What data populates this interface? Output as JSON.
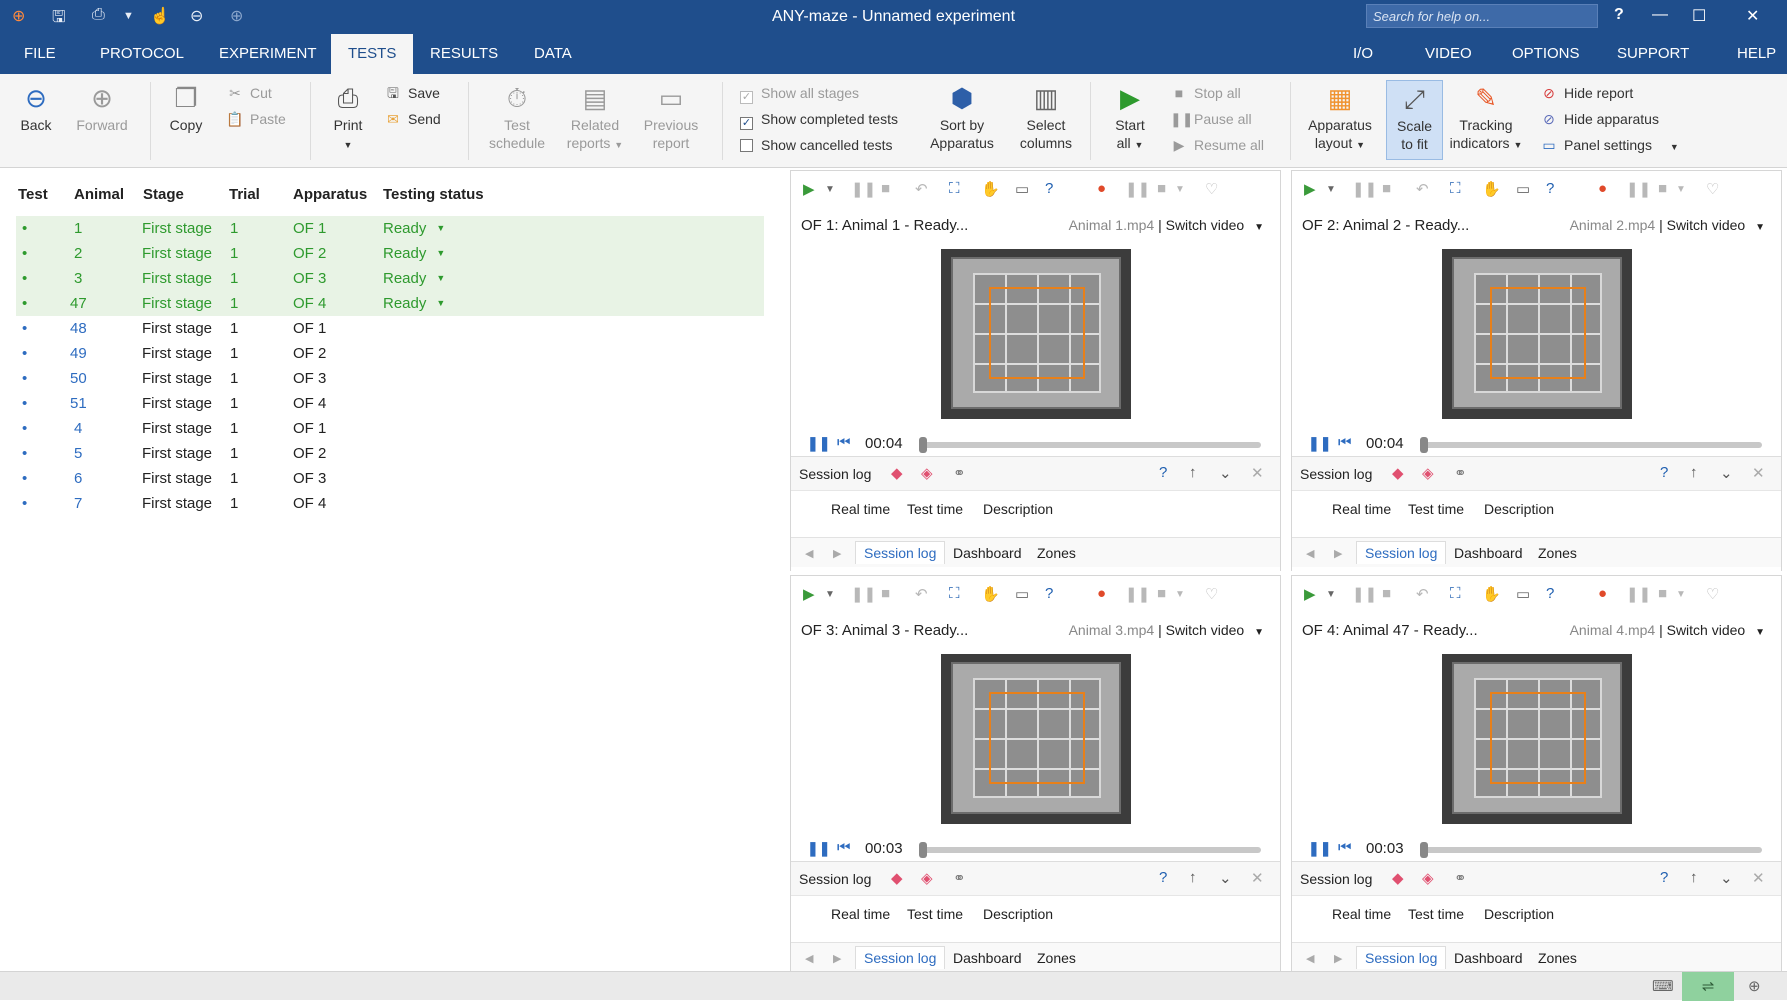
{
  "titlebar": {
    "title": "ANY-maze - Unnamed experiment",
    "search_placeholder": "Search for help on...",
    "help": "?"
  },
  "menu": {
    "left": [
      "FILE",
      "PROTOCOL",
      "EXPERIMENT",
      "TESTS",
      "RESULTS",
      "DATA"
    ],
    "right": [
      "I/O",
      "VIDEO",
      "OPTIONS",
      "SUPPORT",
      "HELP"
    ],
    "active": "TESTS"
  },
  "ribbon": {
    "back": "Back",
    "forward": "Forward",
    "copy": "Copy",
    "cut": "Cut",
    "paste": "Paste",
    "print": "Print",
    "save": "Save",
    "send": "Send",
    "test_schedule": [
      "Test",
      "schedule"
    ],
    "related_reports": [
      "Related",
      "reports"
    ],
    "previous_report": [
      "Previous",
      "report"
    ],
    "show_all_stages": "Show all stages",
    "show_completed_tests": "Show completed tests",
    "show_cancelled_tests": "Show cancelled tests",
    "sort_by": [
      "Sort by",
      "Apparatus"
    ],
    "select_columns": [
      "Select",
      "columns"
    ],
    "start_all": [
      "Start",
      "all"
    ],
    "stop_all": "Stop all",
    "pause_all": "Pause all",
    "resume_all": "Resume all",
    "apparatus_layout": [
      "Apparatus",
      "layout"
    ],
    "scale_to_fit": [
      "Scale",
      "to fit"
    ],
    "tracking_indicators": [
      "Tracking",
      "indicators"
    ],
    "hide_report": "Hide report",
    "hide_apparatus": "Hide apparatus",
    "panel_settings": "Panel settings"
  },
  "tests_table": {
    "headers": [
      "Test",
      "Animal",
      "Stage",
      "Trial",
      "Apparatus",
      "Testing status"
    ],
    "rows": [
      {
        "animal": "1",
        "stage": "First stage",
        "trial": "1",
        "apparatus": "OF 1",
        "status": "Ready"
      },
      {
        "animal": "2",
        "stage": "First stage",
        "trial": "1",
        "apparatus": "OF 2",
        "status": "Ready"
      },
      {
        "animal": "3",
        "stage": "First stage",
        "trial": "1",
        "apparatus": "OF 3",
        "status": "Ready"
      },
      {
        "animal": "47",
        "stage": "First stage",
        "trial": "1",
        "apparatus": "OF 4",
        "status": "Ready"
      },
      {
        "animal": "48",
        "stage": "First stage",
        "trial": "1",
        "apparatus": "OF 1",
        "status": ""
      },
      {
        "animal": "49",
        "stage": "First stage",
        "trial": "1",
        "apparatus": "OF 2",
        "status": ""
      },
      {
        "animal": "50",
        "stage": "First stage",
        "trial": "1",
        "apparatus": "OF 3",
        "status": ""
      },
      {
        "animal": "51",
        "stage": "First stage",
        "trial": "1",
        "apparatus": "OF 4",
        "status": ""
      },
      {
        "animal": "4",
        "stage": "First stage",
        "trial": "1",
        "apparatus": "OF 1",
        "status": ""
      },
      {
        "animal": "5",
        "stage": "First stage",
        "trial": "1",
        "apparatus": "OF 2",
        "status": ""
      },
      {
        "animal": "6",
        "stage": "First stage",
        "trial": "1",
        "apparatus": "OF 3",
        "status": ""
      },
      {
        "animal": "7",
        "stage": "First stage",
        "trial": "1",
        "apparatus": "OF 4",
        "status": ""
      }
    ]
  },
  "panels": [
    {
      "title": "OF 1: Animal 1 - Ready...",
      "file": "Animal 1.mp4",
      "switch": "Switch video",
      "time": "00:04"
    },
    {
      "title": "OF 2: Animal 2 - Ready...",
      "file": "Animal 2.mp4",
      "switch": "Switch video",
      "time": "00:04"
    },
    {
      "title": "OF 3: Animal 3 - Ready...",
      "file": "Animal 3.mp4",
      "switch": "Switch video",
      "time": "00:03"
    },
    {
      "title": "OF 4: Animal 47 - Ready...",
      "file": "Animal 4.mp4",
      "switch": "Switch video",
      "time": "00:03"
    }
  ],
  "session_log": {
    "title": "Session log",
    "columns": [
      "Real time",
      "Test time",
      "Description"
    ],
    "tabs": [
      "Session log",
      "Dashboard",
      "Zones"
    ]
  },
  "colors": {
    "titlebar": "#1f4e8c",
    "ready_green": "#2e9a2e",
    "ready_row_bg": "#e8f3e5",
    "link_blue": "#2e6cc0",
    "zone_orange": "#e8801a"
  }
}
